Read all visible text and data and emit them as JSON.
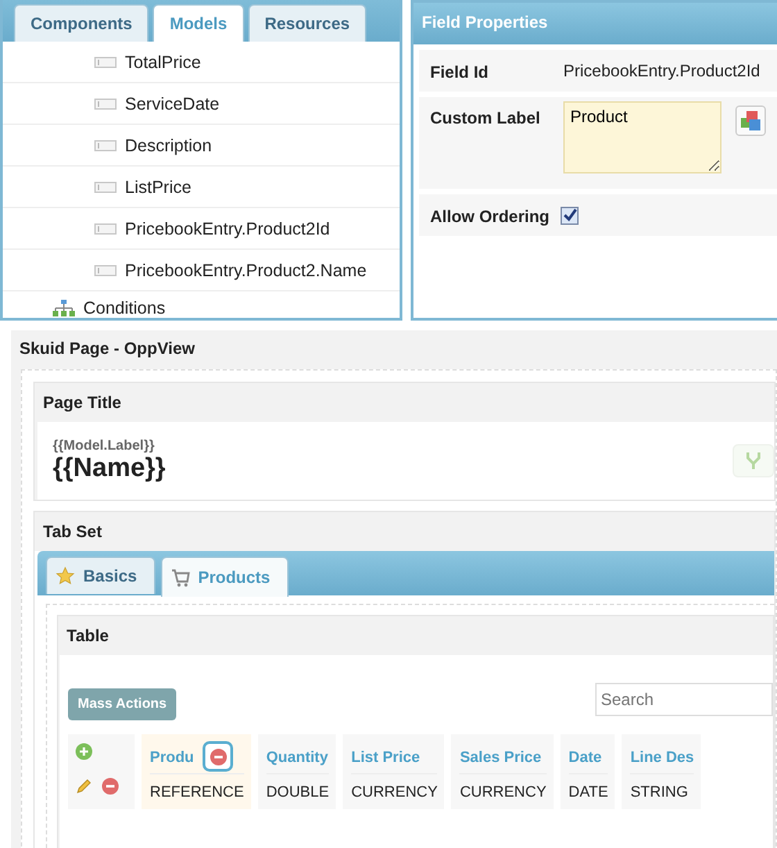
{
  "left_panel": {
    "tabs": [
      {
        "label": "Components",
        "selected": false
      },
      {
        "label": "Models",
        "selected": true
      },
      {
        "label": "Resources",
        "selected": false
      }
    ],
    "items": [
      {
        "label": "TotalPrice",
        "kind": "field"
      },
      {
        "label": "ServiceDate",
        "kind": "field"
      },
      {
        "label": "Description",
        "kind": "field"
      },
      {
        "label": "ListPrice",
        "kind": "field"
      },
      {
        "label": "PricebookEntry.Product2Id",
        "kind": "field"
      },
      {
        "label": "PricebookEntry.Product2.Name",
        "kind": "field"
      },
      {
        "label": "Conditions",
        "kind": "group"
      }
    ]
  },
  "field_properties": {
    "title": "Field Properties",
    "field_id_label": "Field Id",
    "field_id": "PricebookEntry.Product2Id",
    "custom_label_label": "Custom Label",
    "custom_label": "Product",
    "allow_ordering_label": "Allow Ordering",
    "allow_ordering": true
  },
  "page": {
    "title": "Skuid Page - OppView",
    "page_title": {
      "header": "Page Title",
      "subtitle": "{{Model.Label}}",
      "title": "{{Name}}"
    },
    "tab_set": {
      "header": "Tab Set",
      "tabs": [
        {
          "label": "Basics",
          "kind": "star",
          "selected": false
        },
        {
          "label": "Products",
          "kind": "cart",
          "selected": true
        }
      ]
    },
    "table": {
      "header": "Table",
      "mass_actions": "Mass Actions",
      "search_placeholder": "Search",
      "columns": [
        {
          "label": "Produ",
          "type": "REFERENCE",
          "selected": true
        },
        {
          "label": "Quantity",
          "type": "DOUBLE",
          "selected": false
        },
        {
          "label": "List Price",
          "type": "CURRENCY",
          "selected": false
        },
        {
          "label": "Sales Price",
          "type": "CURRENCY",
          "selected": false
        },
        {
          "label": "Date",
          "type": "DATE",
          "selected": false
        },
        {
          "label": "Line Des",
          "type": "STRING",
          "selected": false
        }
      ]
    }
  }
}
